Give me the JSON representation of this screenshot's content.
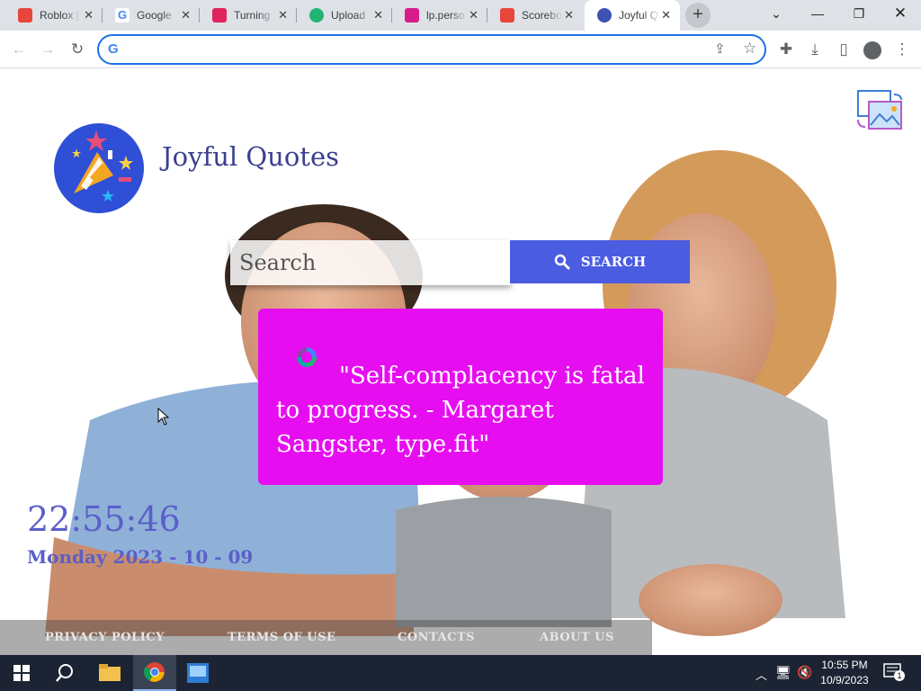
{
  "browser": {
    "tabs": [
      {
        "title": "Roblox | ",
        "favicon_color": "#e8453c"
      },
      {
        "title": "Google",
        "favicon_color": "#4285f4"
      },
      {
        "title": "Turning",
        "favicon_color": "#e0245e"
      },
      {
        "title": "Upload",
        "favicon_color": "#21b573"
      },
      {
        "title": "lp.perso",
        "favicon_color": "#d81b8a"
      },
      {
        "title": "Scorebo",
        "favicon_color": "#e8453c"
      },
      {
        "title": "Joyful Q",
        "favicon_color": "#3f51b5"
      }
    ],
    "active_tab_index": 6,
    "omnibox": {
      "value": "",
      "placeholder": ""
    }
  },
  "page": {
    "brand": "Joyful Quotes",
    "search": {
      "placeholder": "Search",
      "button_label": "SEARCH"
    },
    "quote": {
      "text": "\"Self-complacency is fatal to progress. - Margaret Sangster, type.fit\""
    },
    "clock": {
      "time": "22:55:46",
      "date": "Monday 2023 - 10 - 09"
    },
    "footer": {
      "links": [
        "PRIVACY POLICY",
        "TERMS OF USE",
        "CONTACTS",
        "ABOUT US"
      ]
    },
    "colors": {
      "quote_card": "#e60ef0",
      "search_button": "#4a5ce0",
      "brand_text": "#3a3f8f",
      "clock_text": "#5a5fc8"
    }
  },
  "taskbar": {
    "time": "10:55 PM",
    "date": "10/9/2023",
    "notification_count": "1"
  }
}
